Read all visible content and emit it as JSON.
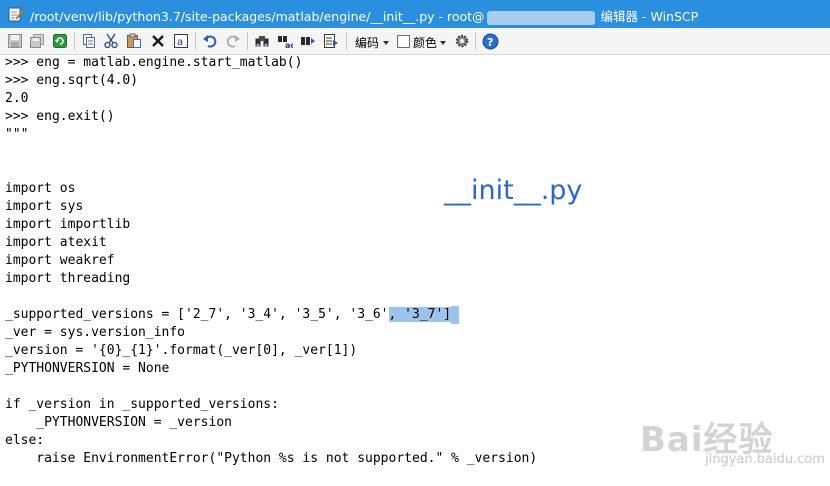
{
  "window": {
    "title_path": "/root/venv/lib/python3.7/site-packages/matlab/engine/__init__.py - root@",
    "title_suffix": " 编辑器 - WinSCP"
  },
  "toolbar": {
    "encoding_label": "编码",
    "color_label": "颜色",
    "icons": [
      "save-icon",
      "save-all-icon",
      "reload-icon",
      "copy-icon",
      "cut-icon",
      "paste-icon",
      "delete-icon",
      "select-all-icon",
      "undo-icon",
      "redo-icon",
      "find-icon",
      "replace-icon",
      "find-next-icon",
      "goto-line-icon",
      "settings-icon",
      "help-icon"
    ]
  },
  "editor": {
    "lines": [
      ">>> eng = matlab.engine.start_matlab()",
      ">>> eng.sqrt(4.0)",
      "2.0",
      ">>> eng.exit()",
      "\"\"\"",
      "",
      "",
      "import os",
      "import sys",
      "import importlib",
      "import atexit",
      "import weakref",
      "import threading",
      "",
      "_supported_versions = ['2_7', '3_4', '3_5', '3_6'",
      "_ver = sys.version_info",
      "_version = '{0}_{1}'.format(_ver[0], _ver[1])",
      "_PYTHONVERSION = None",
      "",
      "if _version in _supported_versions:",
      "    _PYTHONVERSION = _version",
      "else:",
      "    raise EnvironmentError(\"Python %s is not supported.\" % _version)"
    ],
    "selected_text": ", '3_7']"
  },
  "overlay_label": "__init__.py",
  "watermark": {
    "brand": "Bai经验",
    "url": "jingyan.baidu.com"
  }
}
